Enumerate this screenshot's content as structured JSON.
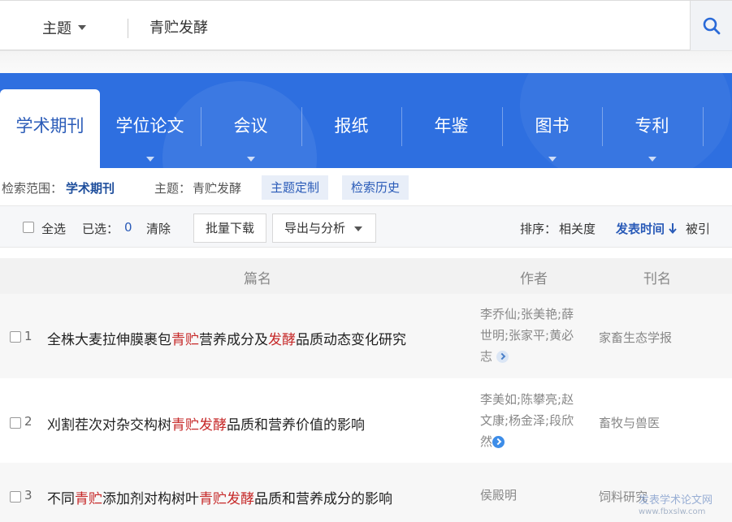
{
  "search": {
    "field": "主题",
    "query": "青贮发酵"
  },
  "tabs": [
    {
      "label": "学术期刊",
      "active": true,
      "has_dropdown": false
    },
    {
      "label": "学位论文",
      "active": false,
      "has_dropdown": true
    },
    {
      "label": "会议",
      "active": false,
      "has_dropdown": true
    },
    {
      "label": "报纸",
      "active": false,
      "has_dropdown": false
    },
    {
      "label": "年鉴",
      "active": false,
      "has_dropdown": false
    },
    {
      "label": "图书",
      "active": false,
      "has_dropdown": true
    },
    {
      "label": "专利",
      "active": false,
      "has_dropdown": true
    }
  ],
  "scope": {
    "label": "检索范围：",
    "value": "学术期刊",
    "topic_label": "主题：",
    "topic_value": "青贮发酵",
    "custom_btn": "主题定制",
    "history_btn": "检索历史"
  },
  "toolbar": {
    "select_all": "全选",
    "selected_label": "已选：",
    "selected_count": "0",
    "clear": "清除",
    "batch_download": "批量下载",
    "export_analysis": "导出与分析",
    "sort_label": "排序：",
    "sort_relevance": "相关度",
    "sort_date": "发表时间",
    "sort_cited": "被引"
  },
  "table": {
    "headers": {
      "title": "篇名",
      "author": "作者",
      "journal": "刊名"
    },
    "rows": [
      {
        "num": "1",
        "title_parts": [
          "全株大麦拉伸膜裹包",
          "青贮",
          "营养成分及",
          "发酵",
          "品质动态变化研究"
        ],
        "authors": [
          "李乔仙;张美艳;薛",
          "世明;张家平;黄必",
          "志"
        ],
        "journal": "家畜生态学报"
      },
      {
        "num": "2",
        "title_parts": [
          "刈割茬次对杂交构树",
          "青贮发酵",
          "品质和营养价值的影响"
        ],
        "authors": [
          "李美如;陈攀亮;赵",
          "文康;杨金泽;段欣",
          "然"
        ],
        "journal": "畜牧与兽医"
      },
      {
        "num": "3",
        "title_parts": [
          "不同",
          "青贮",
          "添加剂对构树叶",
          "青贮发酵",
          "品质和营养成分的影响"
        ],
        "authors": [
          "侯殿明"
        ],
        "journal": "饲料研究"
      }
    ]
  },
  "watermark": {
    "text": "发表学术论文网",
    "url": "www.fbxslw.com"
  },
  "colors": {
    "brand_blue": "#2e6fe0",
    "highlight_red": "#c62828",
    "link_blue": "#2a5bb8"
  }
}
